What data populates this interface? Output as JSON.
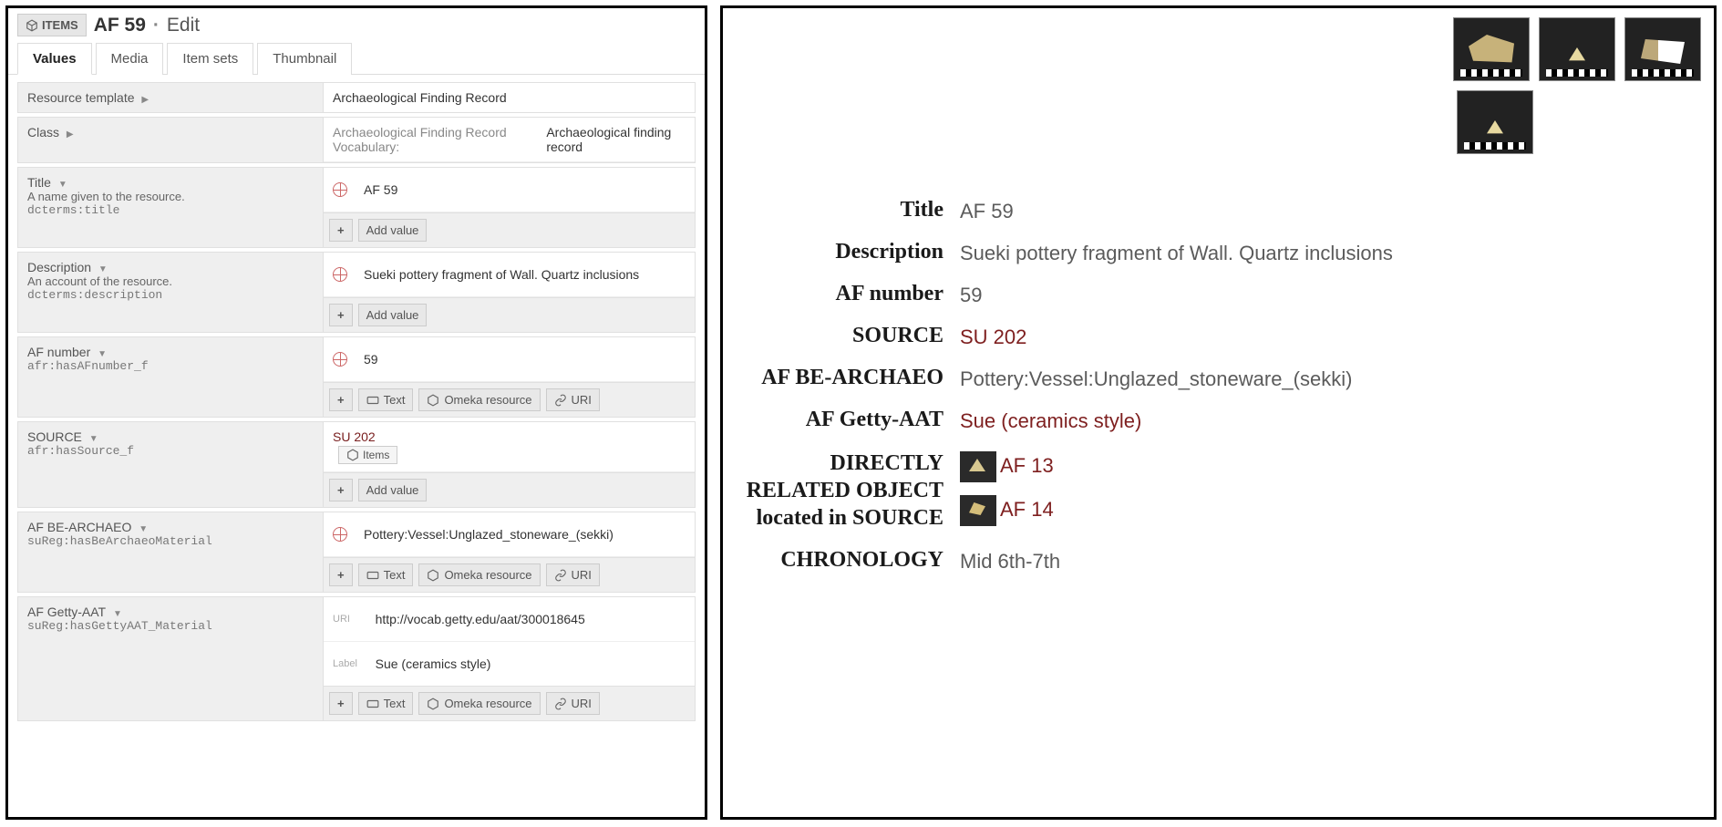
{
  "left": {
    "breadcrumb": {
      "items_label": "ITEMS",
      "title": "AF 59",
      "sep": "·",
      "mode": "Edit"
    },
    "tabs": [
      "Values",
      "Media",
      "Item sets",
      "Thumbnail"
    ],
    "active_tab": "Values",
    "template_row": {
      "label": "Resource template",
      "value": "Archaeological Finding Record"
    },
    "class_row": {
      "label": "Class",
      "prefix": "Archaeological Finding Record Vocabulary:",
      "value": "Archaeological finding record"
    },
    "buttons": {
      "add_value": "Add value",
      "text": "Text",
      "omeka": "Omeka resource",
      "uri": "URI",
      "items": "Items"
    },
    "labels": {
      "uri": "URI",
      "label": "Label"
    },
    "fields": [
      {
        "key": "title",
        "label": "Title",
        "hint": "A name given to the resource.",
        "term": "dcterms:title",
        "value": "AF 59",
        "addbar": "simple"
      },
      {
        "key": "description",
        "label": "Description",
        "hint": "An account of the resource.",
        "term": "dcterms:description",
        "value": "Sueki pottery fragment of Wall. Quartz inclusions",
        "addbar": "simple"
      },
      {
        "key": "afnumber",
        "label": "AF number",
        "term": "afr:hasAFnumber_f",
        "value": "59",
        "addbar": "full"
      },
      {
        "key": "source",
        "label": "SOURCE",
        "term": "afr:hasSource_f",
        "value_link": "SU 202",
        "chip": "Items",
        "addbar": "simple"
      },
      {
        "key": "bearchaeo",
        "label": "AF BE-ARCHAEO",
        "term": "suReg:hasBeArchaeoMaterial",
        "value": "Pottery:Vessel:Unglazed_stoneware_(sekki)",
        "addbar": "full"
      },
      {
        "key": "gettyaat",
        "label": "AF Getty-AAT",
        "term": "suReg:hasGettyAAT_Material",
        "uri": "http://vocab.getty.edu/aat/300018645",
        "uri_label": "Sue (ceramics style)",
        "addbar": "full"
      }
    ]
  },
  "right": {
    "rows": [
      {
        "label": "Title",
        "value": "AF 59"
      },
      {
        "label": "Description",
        "value": "Sueki pottery fragment of Wall. Quartz inclusions"
      },
      {
        "label": "AF number",
        "value": "59"
      },
      {
        "label": "SOURCE",
        "value": "SU 202",
        "red": true
      },
      {
        "label": "AF BE-ARCHAEO",
        "value": "Pottery:Vessel:Unglazed_stoneware_(sekki)"
      },
      {
        "label": "AF Getty-AAT",
        "value": "Sue (ceramics style)",
        "red": true
      },
      {
        "label": "DIRECTLY RELATED OBJECT located in SOURCE",
        "value1": "AF 13",
        "value2": "AF 14",
        "red": true,
        "thumbs": true,
        "multiline": true
      },
      {
        "label": "CHRONOLOGY",
        "value": "Mid 6th-7th"
      }
    ]
  }
}
